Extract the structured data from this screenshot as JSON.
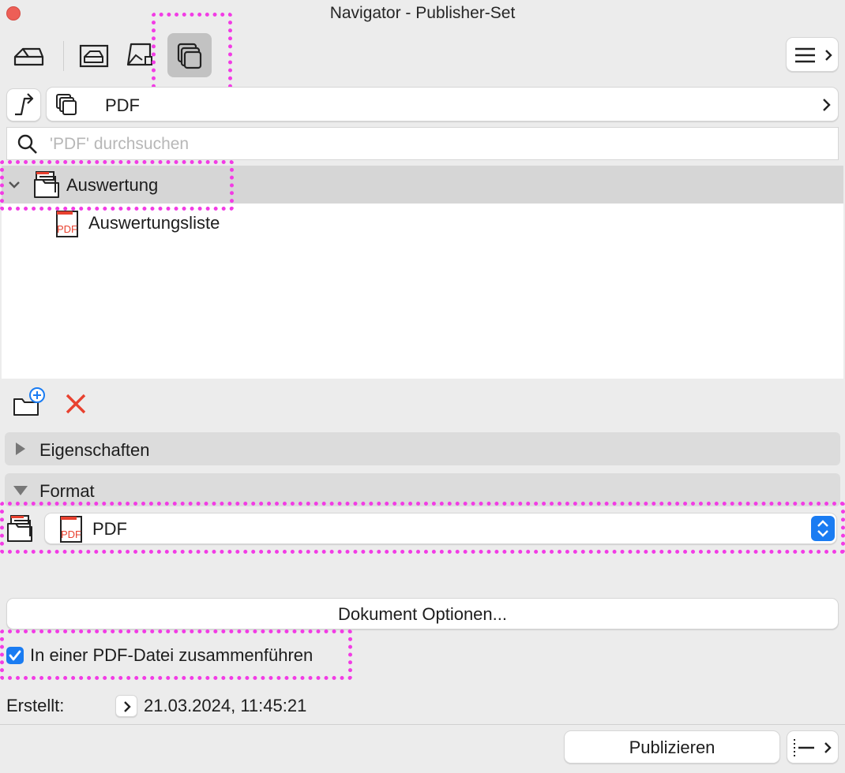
{
  "window": {
    "title": "Navigator - Publisher-Set"
  },
  "toolbar": {
    "items": [
      {
        "icon": "project-map-icon"
      },
      {
        "icon": "view-map-icon"
      },
      {
        "icon": "layout-book-icon"
      },
      {
        "icon": "publisher-sets-icon",
        "active": true
      }
    ],
    "menu_icon": "hamburger-menu-icon"
  },
  "path": {
    "current": "PDF"
  },
  "search": {
    "placeholder": "'PDF' durchsuchen"
  },
  "tree": {
    "folder": {
      "label": "Auswertung",
      "expanded": true
    },
    "items": [
      {
        "label": "Auswertungsliste",
        "icon": "pdf-icon"
      }
    ]
  },
  "sections": {
    "properties": "Eigenschaften",
    "format": "Format"
  },
  "format": {
    "selected": "PDF"
  },
  "buttons": {
    "document_options": "Dokument Optionen...",
    "publish": "Publizieren"
  },
  "merge": {
    "label": "In einer PDF-Datei zusammenführen",
    "checked": true
  },
  "created": {
    "label": "Erstellt:",
    "value": "21.03.2024, 11:45:21"
  },
  "colors": {
    "highlight": "#f23ce5",
    "accent": "#1a7cf2",
    "delete": "#e8412f"
  }
}
